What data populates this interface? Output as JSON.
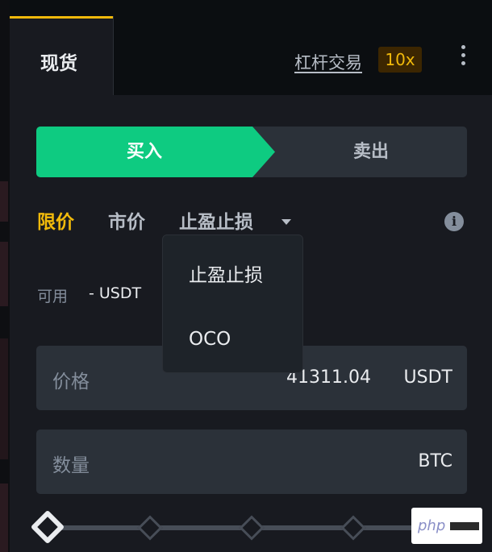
{
  "header": {
    "tab_spot": "现货",
    "margin_link": "杠杆交易",
    "leverage": "10x",
    "more_icon": "more-vertical-icon"
  },
  "side": {
    "buy": "买入",
    "sell": "卖出"
  },
  "order_types": {
    "limit": "限价",
    "market": "市价",
    "stop": "止盈止损",
    "info_icon": "info-icon"
  },
  "dropdown": {
    "items": [
      "止盈止损",
      "OCO"
    ]
  },
  "available": {
    "label": "可用",
    "value": "- USDT"
  },
  "price_field": {
    "label": "价格",
    "value": "41311.04",
    "unit": "USDT"
  },
  "qty_field": {
    "label": "数量",
    "unit": "BTC"
  },
  "slider": {
    "value_percent": 0
  },
  "watermark": {
    "text": "php"
  },
  "colors": {
    "accent": "#f0b90b",
    "buy": "#0ecb81",
    "bg": "#181a20",
    "field": "#2b3139"
  }
}
